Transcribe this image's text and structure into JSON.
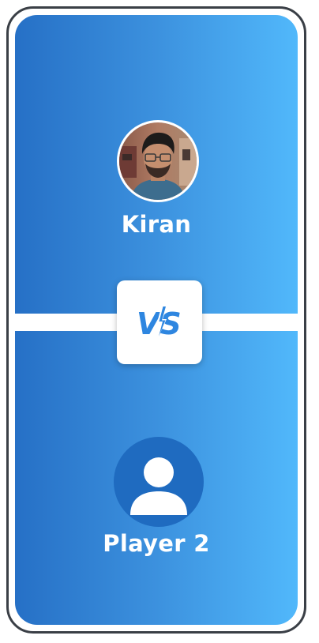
{
  "player1": {
    "name": "Kiran",
    "avatar": "profile-photo"
  },
  "versus": {
    "label": "VS",
    "icon": "vs-lightning-icon",
    "color": "#2e86e0"
  },
  "player2": {
    "name": "Player 2",
    "avatar": "person-silhouette-icon"
  },
  "colors": {
    "gradient_start": "#2670c6",
    "gradient_end": "#51b8fb",
    "frame": "#3a3f46",
    "placeholder_bg": "#1f6bc0"
  }
}
